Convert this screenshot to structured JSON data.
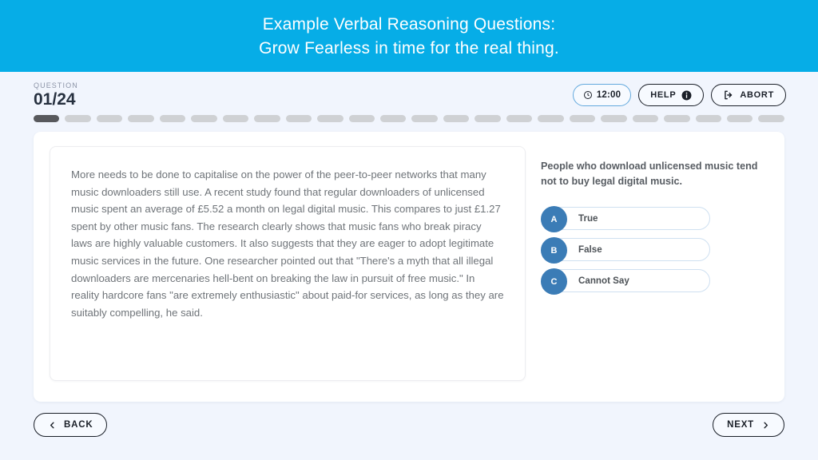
{
  "banner": {
    "line1": "Example Verbal Reasoning Questions:",
    "line2": "Grow Fearless in time for the real thing.",
    "color": "#06ADE7"
  },
  "header": {
    "question_label": "QUESTION",
    "question_counter": "01/24",
    "timer": {
      "value": "12:00",
      "icon": "clock-icon",
      "border_color": "#63a9dd"
    },
    "help_button": {
      "label": "HELP",
      "icon": "info-icon"
    },
    "abort_button": {
      "label": "ABORT",
      "icon": "exit-icon"
    }
  },
  "progress": {
    "total": 24,
    "current": 1,
    "active_color": "#58595d",
    "inactive_color": "#cfd1d4"
  },
  "passage": {
    "text": "More needs to be done to capitalise on the power of the peer-to-peer networks that many music downloaders still use. A recent study found that regular downloaders of unlicensed music spent an average of £5.52 a month on legal digital music. This compares to just £1.27 spent by other music fans. The research clearly shows that music fans who break piracy laws are highly valuable customers. It also suggests that they are eager to adopt legitimate music services in the future. One researcher pointed out that \"There's a myth that all illegal downloaders are mercenaries hell-bent on breaking the law in pursuit of free music.\" In reality hardcore fans \"are extremely enthusiastic\" about paid-for services, as long as they are suitably compelling, he said."
  },
  "question": {
    "statement": "People who download unlicensed music tend not to buy legal digital music.",
    "options": [
      {
        "key": "A",
        "label": "True"
      },
      {
        "key": "B",
        "label": "False"
      },
      {
        "key": "C",
        "label": "Cannot Say"
      }
    ],
    "badge_color": "#3b7cb6"
  },
  "footer": {
    "back_button": {
      "label": "BACK",
      "icon": "chevron-left-icon"
    },
    "next_button": {
      "label": "NEXT",
      "icon": "chevron-right-icon"
    }
  }
}
